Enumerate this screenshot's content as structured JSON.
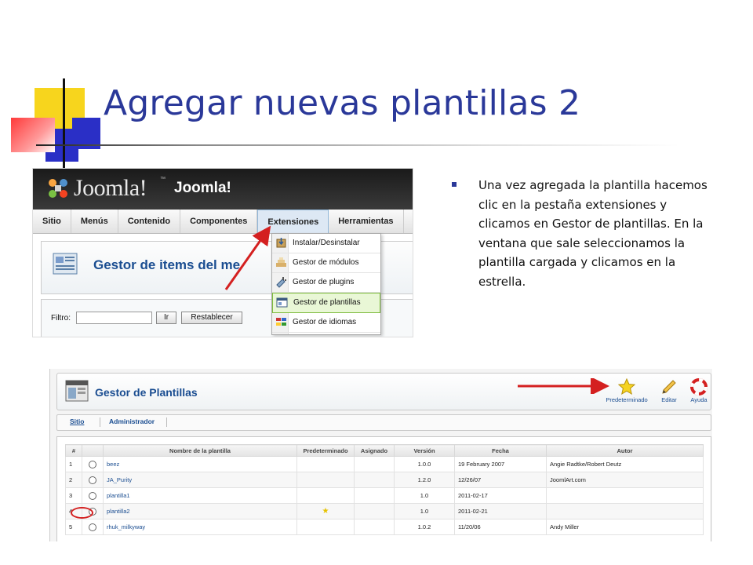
{
  "slide": {
    "title": "Agregar nuevas plantillas 2",
    "bullet": "Una vez agregada la plantilla hacemos clic en la pestaña extensiones  y clicamos en Gestor de plantillas. En la ventana que sale seleccionamos la plantilla cargada y clicamos en la estrella."
  },
  "joomla_admin": {
    "logo_text": "Joomla!",
    "logo_tm": "™",
    "site_name": "Joomla!",
    "menu": [
      "Sitio",
      "Menús",
      "Contenido",
      "Componentes",
      "Extensiones",
      "Herramientas"
    ],
    "active_menu": "Extensiones",
    "page_title": "Gestor de items del me",
    "filter_label": "Filtro:",
    "filter_value": "",
    "go_button": "Ir",
    "reset_button": "Restablecer",
    "extensions_dropdown": [
      {
        "label": "Instalar/Desinstalar",
        "icon": "install-icon"
      },
      {
        "label": "Gestor de módulos",
        "icon": "modules-icon"
      },
      {
        "label": "Gestor de plugins",
        "icon": "plugins-icon"
      },
      {
        "label": "Gestor de plantillas",
        "icon": "templates-icon",
        "highlighted": true
      },
      {
        "label": "Gestor de idiomas",
        "icon": "languages-icon"
      }
    ]
  },
  "template_manager": {
    "title": "Gestor de Plantillas",
    "toolbar": [
      {
        "label": "Predeterminado",
        "icon": "star-icon"
      },
      {
        "label": "Editar",
        "icon": "edit-pencil-icon"
      },
      {
        "label": "Ayuda",
        "icon": "help-lifebuoy-icon"
      }
    ],
    "tabs": [
      "Sitio",
      "Administrador"
    ],
    "columns": [
      "#",
      "",
      "Nombre de la plantilla",
      "Predeterminado",
      "Asignado",
      "Versión",
      "Fecha",
      "Autor"
    ],
    "rows": [
      {
        "num": "1",
        "name": "beez",
        "default": false,
        "assigned": "",
        "version": "1.0.0",
        "date": "19 February 2007",
        "author": "Angie Radtke/Robert Deutz"
      },
      {
        "num": "2",
        "name": "JA_Purity",
        "default": false,
        "assigned": "",
        "version": "1.2.0",
        "date": "12/26/07",
        "author": "JoomlArt.com"
      },
      {
        "num": "3",
        "name": "plantilla1",
        "default": false,
        "assigned": "",
        "version": "1.0",
        "date": "2011-02-17",
        "author": ""
      },
      {
        "num": "4",
        "name": "plantilla2",
        "default": true,
        "assigned": "",
        "version": "1.0",
        "date": "2011-02-21",
        "author": ""
      },
      {
        "num": "5",
        "name": "rhuk_milkyway",
        "default": false,
        "assigned": "",
        "version": "1.0.2",
        "date": "11/20/06",
        "author": "Andy Miller"
      }
    ],
    "default_marker": "★"
  },
  "colors": {
    "title": "#2a3899",
    "joomla_blue": "#1a4d91",
    "annotation_red": "#d42020",
    "highlight_green": "#7dbb3c"
  }
}
